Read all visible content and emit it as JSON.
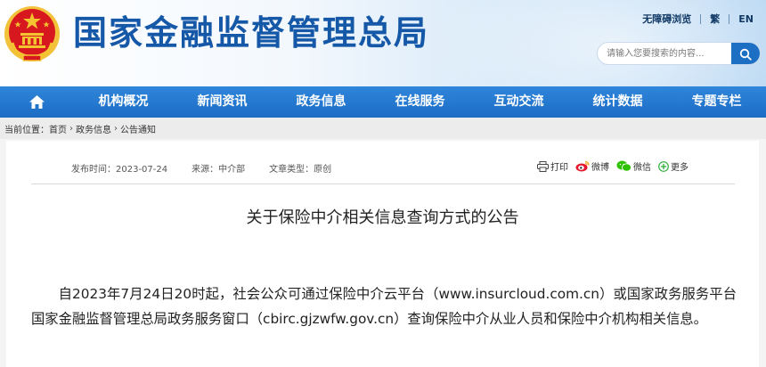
{
  "header": {
    "site_title": "国家金融监督管理总局",
    "top_links": [
      "无障碍浏览",
      "繁",
      "EN"
    ],
    "search_placeholder": "请输入您要搜索的内容..."
  },
  "nav": {
    "items": [
      "机构概况",
      "新闻资讯",
      "政务信息",
      "在线服务",
      "互动交流",
      "统计数据",
      "专题专栏"
    ]
  },
  "breadcrumb": {
    "label": "当前位置：",
    "items": [
      "首页",
      "政务信息",
      "公告通知"
    ]
  },
  "article": {
    "meta": {
      "publish_time": "发布时间：2023-07-24",
      "source": "来源：中介部",
      "doc_type": "文章类型：原创"
    },
    "share": [
      "打印",
      "微博",
      "微信",
      "更多"
    ],
    "title": "关于保险中介相关信息查询方式的公告",
    "body": "自2023年7月24日20时起，社会公众可通过保险中介云平台（www.insurcloud.com.cn）或国家政务服务平台国家金融监督管理总局政务服务窗口（cbirc.gjzwfw.gov.cn）查询保险中介从业人员和保险中介机构相关信息。"
  },
  "colors": {
    "brand_blue": "#1558a8",
    "nav_blue": "#2478d0",
    "emblem_red": "#d7191f",
    "emblem_gold": "#f4c430"
  }
}
